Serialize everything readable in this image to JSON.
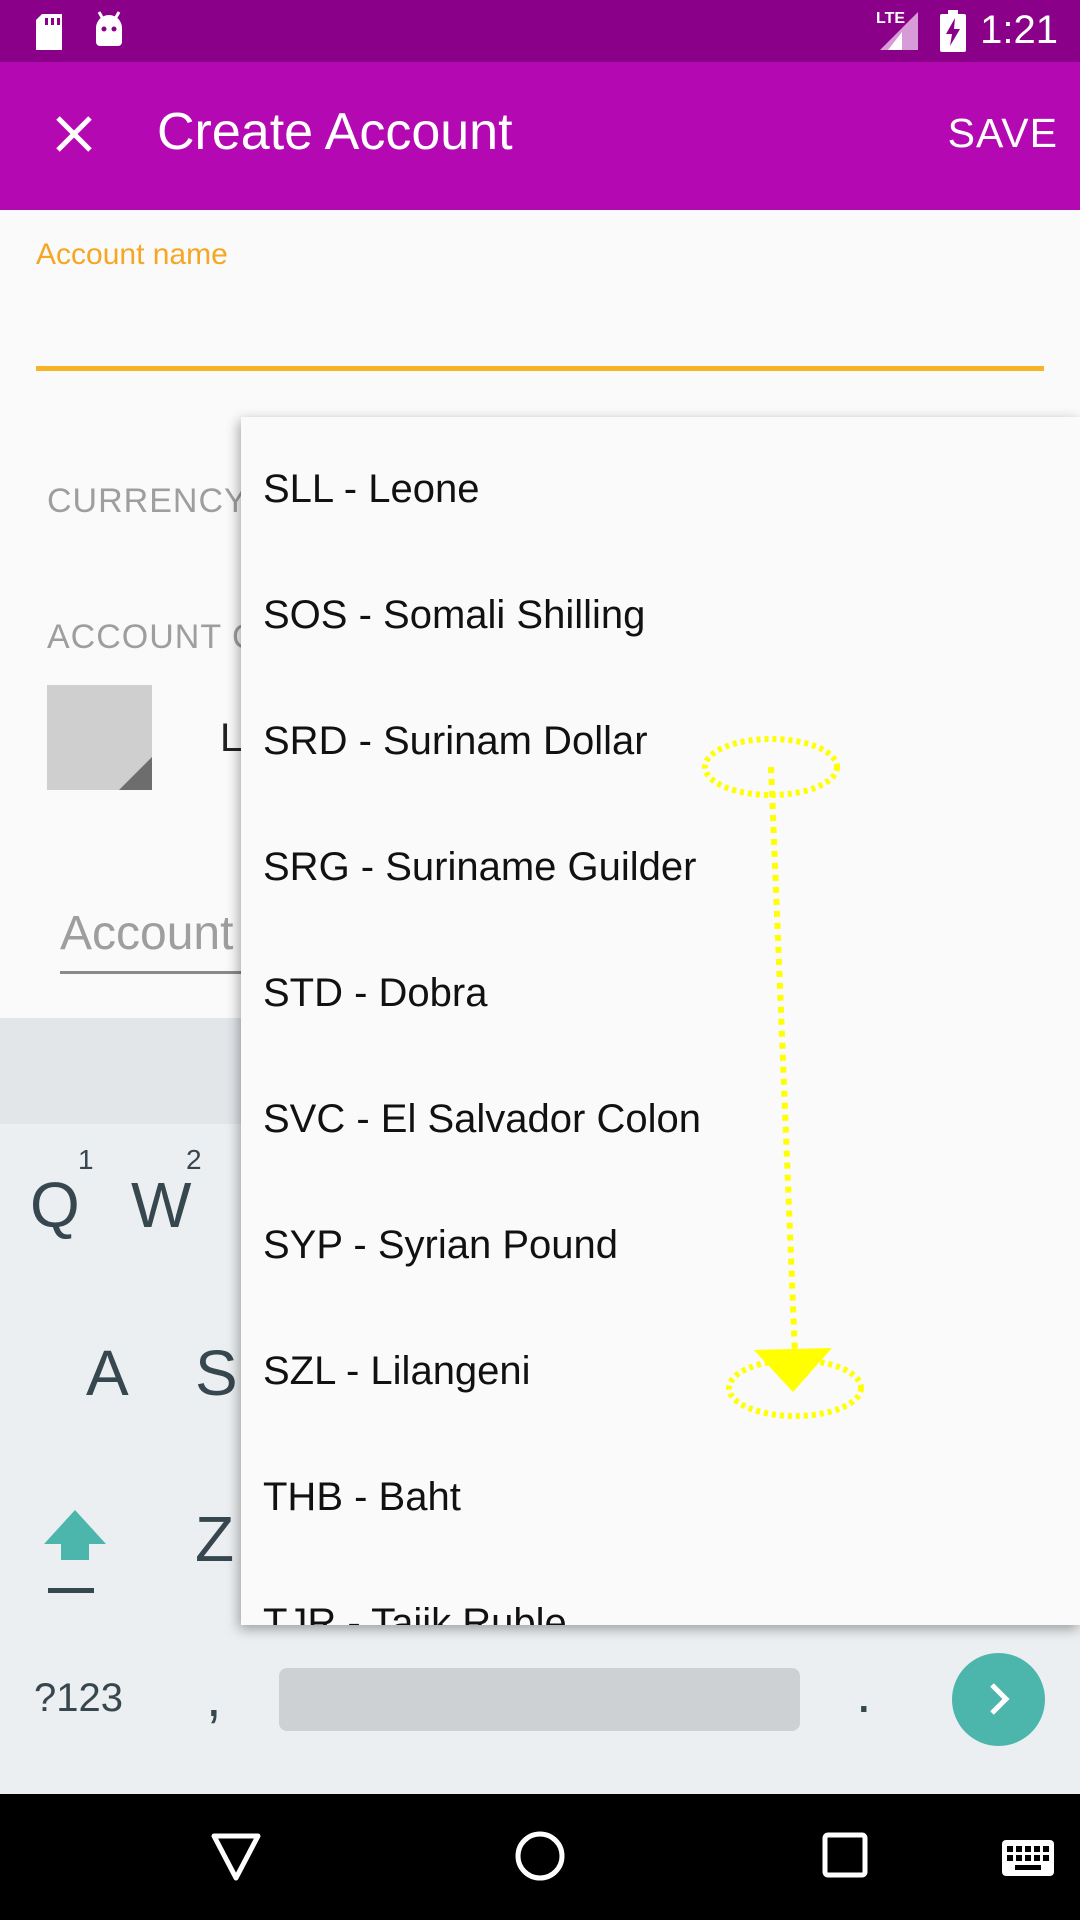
{
  "status_bar": {
    "time": "1:21",
    "network": "LTE",
    "icons": [
      "sd-card-icon",
      "android-icon",
      "lte-signal-icon",
      "battery-charging-icon"
    ]
  },
  "app_bar": {
    "title": "Create Account",
    "save_label": "SAVE",
    "close_icon": "close-icon"
  },
  "form": {
    "account_name_label": "Account name",
    "currency_label": "CURRENCY",
    "account_color_label": "ACCOUNT C",
    "color_value_partial": "L",
    "description_placeholder": "Account"
  },
  "currency_dropdown": {
    "options": [
      "SLL - Leone",
      "SOS - Somali Shilling",
      "SRD - Surinam Dollar",
      "SRG - Suriname Guilder",
      "STD - Dobra",
      "SVC - El Salvador Colon",
      "SYP - Syrian Pound",
      "SZL - Lilangeni",
      "THB - Baht",
      "TJR - Tajik Ruble"
    ]
  },
  "keyboard": {
    "row1": [
      "Q",
      "W"
    ],
    "row1_hints": [
      "1",
      "2"
    ],
    "row2": [
      "A",
      "S"
    ],
    "row3": [
      "Z"
    ],
    "symbols_key": "?123",
    "comma_key": ",",
    "period_key": "."
  },
  "gesture_overlay": {
    "type": "swipe-down",
    "color": "#ffff00"
  },
  "colors": {
    "status_bar": "#8b0088",
    "app_bar": "#b308b2",
    "accent": "#f5a623",
    "keyboard_action": "#4db6ac"
  }
}
